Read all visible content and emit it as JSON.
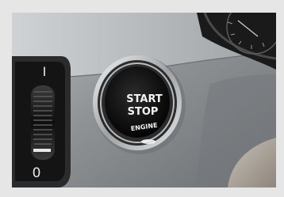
{
  "photo": {
    "subject": "car dashboard start/stop engine button",
    "button": {
      "line1": "START",
      "line2": "STOP",
      "line3": "ENGINE"
    },
    "dial": {
      "top_mark": "I",
      "bottom_mark": "0"
    }
  },
  "colors": {
    "frame": "#e6e6e6",
    "dashboard": "#8f9396",
    "button_face": "#0d0d0d",
    "chrome_ring": "#dcdfe1",
    "label_text": "#f4f4f4"
  }
}
